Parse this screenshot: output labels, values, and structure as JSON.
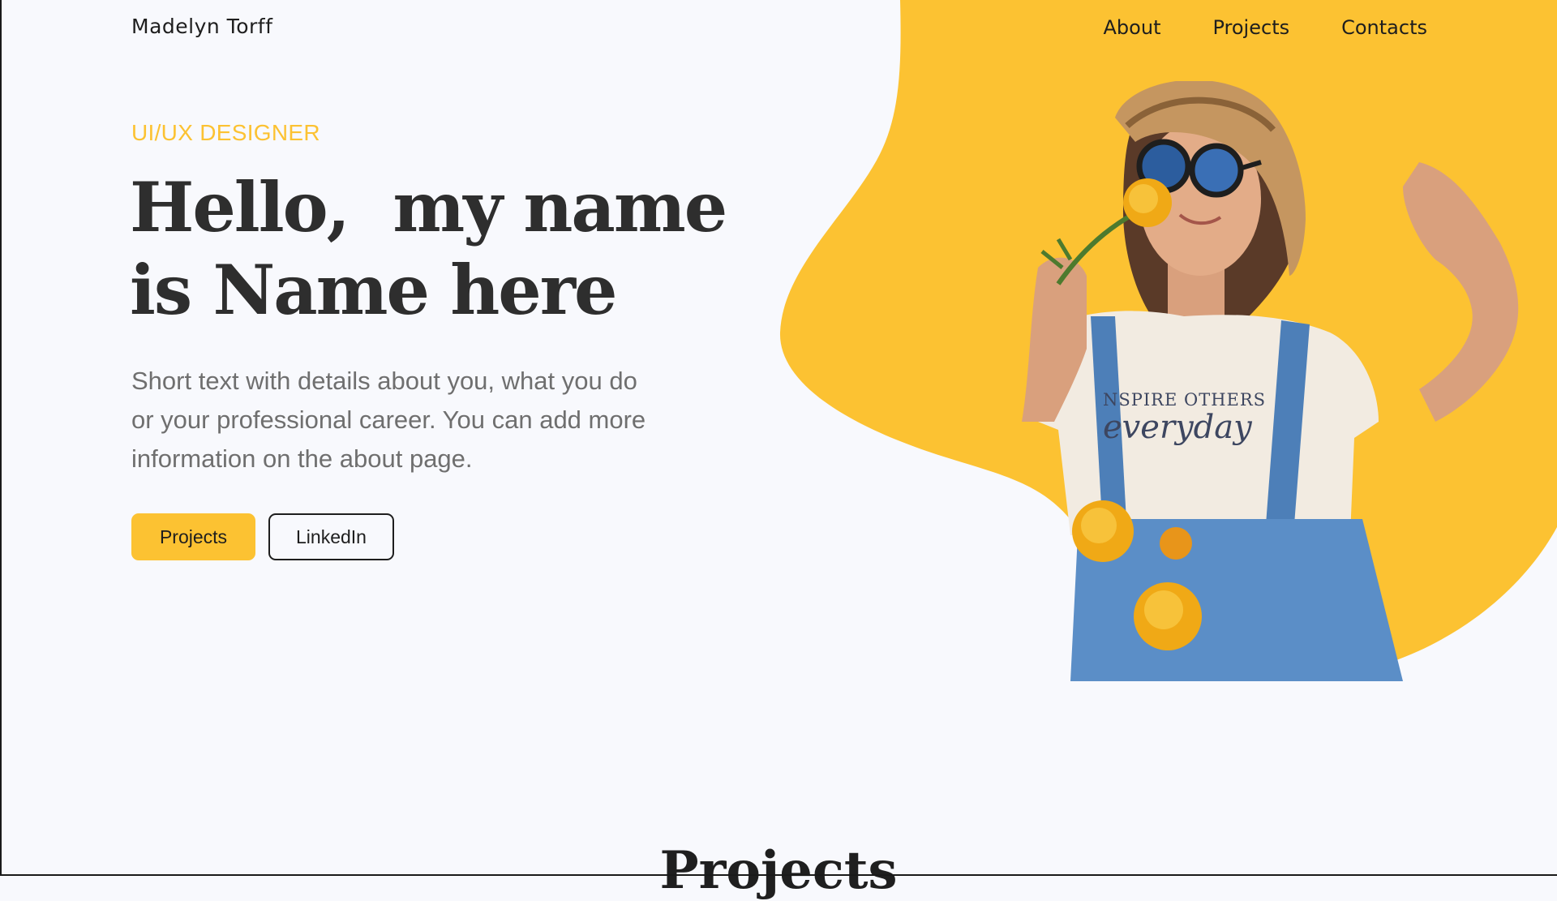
{
  "header": {
    "logo": "Madelyn Torff",
    "nav": [
      {
        "label": "About"
      },
      {
        "label": "Projects"
      },
      {
        "label": "Contacts"
      }
    ]
  },
  "hero": {
    "eyebrow": "UI/UX DESIGNER",
    "headline_line1": "Hello,  my name",
    "headline_line2": "is Name here",
    "description": "Short text with details about you, what you do or your professional career. You can add more information on the about page.",
    "primary_button": "Projects",
    "secondary_button": "LinkedIn",
    "photo_shirt_text_line1": "NSPIRE OTHERS",
    "photo_shirt_text_line2": "everyday"
  },
  "projects_section": {
    "title": "Projects"
  },
  "colors": {
    "accent": "#fcc232",
    "background": "#f8f9fd",
    "text_dark": "#2e2e2e",
    "text_muted": "#6f6f6f"
  }
}
